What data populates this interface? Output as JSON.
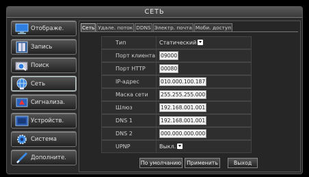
{
  "window": {
    "title": "СЕТЬ"
  },
  "sidebar": {
    "items": [
      {
        "label": "Отображе.",
        "icon": "monitor-icon",
        "active": false
      },
      {
        "label": "Запись",
        "icon": "film-icon",
        "active": false
      },
      {
        "label": "Поиск",
        "icon": "search-icon",
        "active": false
      },
      {
        "label": "Сеть",
        "icon": "network-icon",
        "active": true
      },
      {
        "label": "Сигнализа.",
        "icon": "alarm-icon",
        "active": false
      },
      {
        "label": "Устройств.",
        "icon": "device-icon",
        "active": false
      },
      {
        "label": "Система",
        "icon": "gear-icon",
        "active": false
      },
      {
        "label": "Дополните.",
        "icon": "pen-icon",
        "active": false
      }
    ]
  },
  "tabs": [
    {
      "label": "Сеть",
      "active": true
    },
    {
      "label": "Удале. поток",
      "active": false
    },
    {
      "label": "DDNS",
      "active": false
    },
    {
      "label": "Электр. почта",
      "active": false
    },
    {
      "label": "Моби. доступ",
      "active": false
    }
  ],
  "settings": [
    {
      "label": "Тип",
      "kind": "select",
      "value": "Статический"
    },
    {
      "label": "Порт клиента",
      "kind": "input",
      "value": "09000"
    },
    {
      "label": "Порт HTTP",
      "kind": "input",
      "value": "00080"
    },
    {
      "label": "IP-адрес",
      "kind": "input",
      "value": "010.000.100.187"
    },
    {
      "label": "Маска сети",
      "kind": "input",
      "value": "255.255.255.000"
    },
    {
      "label": "Шлюз",
      "kind": "input",
      "value": "192.168.001.001"
    },
    {
      "label": "DNS 1",
      "kind": "input",
      "value": "192.168.001.001"
    },
    {
      "label": "DNS 2",
      "kind": "input",
      "value": "000.000.000.000"
    },
    {
      "label": "UPNP",
      "kind": "select",
      "value": "Выкл."
    }
  ],
  "actions": {
    "default_label": "По умолчанию",
    "apply_label": "Применить",
    "exit_label": "Выход"
  },
  "colors": {
    "background": "#2b2b2b",
    "accent": "#2f6fd0",
    "input_bg": "#f2f2f2"
  }
}
